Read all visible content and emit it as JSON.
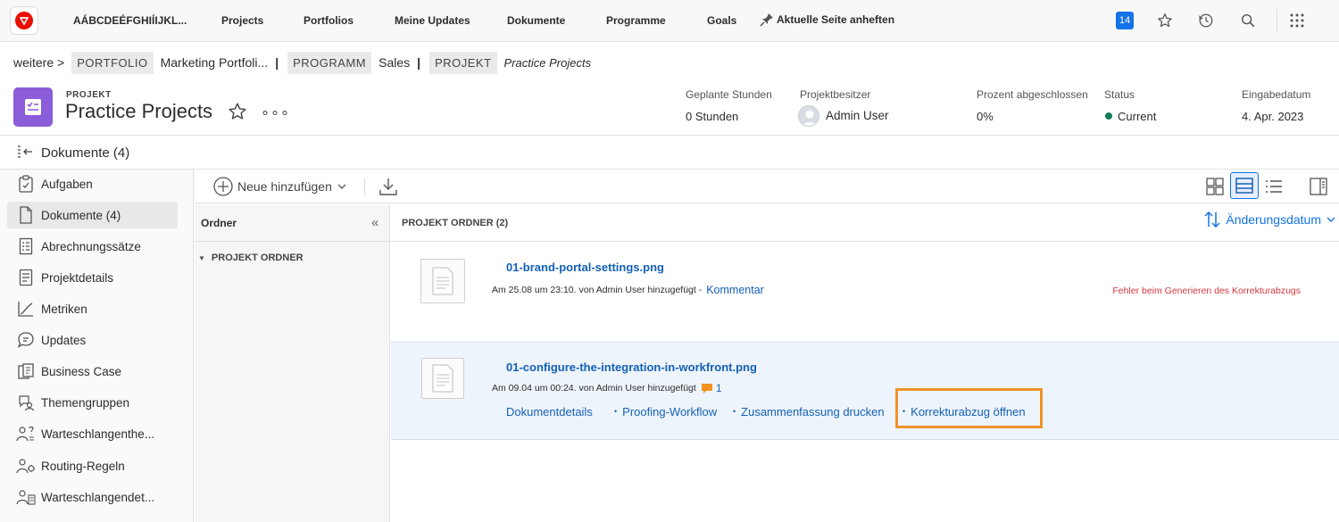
{
  "topnav": {
    "org_name": "AÁBCDEÉFGHIÍIJKL...",
    "items": [
      "Projects",
      "Portfolios",
      "Meine Updates",
      "Dokumente",
      "Programme",
      "Goals"
    ],
    "pin_label": "Aktuelle Seite anheften",
    "notification_count": "14"
  },
  "breadcrumb": {
    "more": "weitere >",
    "portfolio_tag": "PORTFOLIO",
    "portfolio_name": "Marketing Portfoli...",
    "program_tag": "PROGRAMM",
    "program_name": "Sales",
    "project_tag": "PROJEKT",
    "project_name": "Practice Projects",
    "separator": "|"
  },
  "project": {
    "type_label": "PROJEKT",
    "title": "Practice Projects",
    "more": "∘∘∘",
    "fields": {
      "planned_hours_label": "Geplante Stunden",
      "planned_hours_value": "0 Stunden",
      "owner_label": "Projektbesitzer",
      "owner_value": "Admin User",
      "percent_label": "Prozent abgeschlossen",
      "percent_value": "0%",
      "status_label": "Status",
      "status_value": "Current",
      "entry_date_label": "Eingabedatum",
      "entry_date_value": "4. Apr. 2023"
    }
  },
  "section": {
    "title": "Dokumente (4)"
  },
  "leftnav": {
    "items": [
      {
        "label": "Aufgaben"
      },
      {
        "label": "Dokumente (4)"
      },
      {
        "label": "Abrechnungssätze"
      },
      {
        "label": "Projektdetails"
      },
      {
        "label": "Metriken"
      },
      {
        "label": "Updates"
      },
      {
        "label": "Business Case"
      },
      {
        "label": "Themengruppen"
      },
      {
        "label": "Warteschlangenthe..."
      },
      {
        "label": "Routing-Regeln"
      },
      {
        "label": "Warteschlangendet..."
      }
    ]
  },
  "toolbar": {
    "add_label": "Neue hinzufügen"
  },
  "folders": {
    "title": "Ordner",
    "collapse": "«",
    "items": [
      "PROJEKT ORDNER"
    ]
  },
  "main": {
    "title": "PROJEKT ORDNER (2)",
    "sort_label": "Änderungsdatum",
    "documents": [
      {
        "name": "01-brand-portal-settings.png",
        "meta": "Am 25.08 um 23:10. von Admin User hinzugefügt -",
        "comment_link": "Kommentar",
        "error": "Fehler beim Generieren des Korrekturabzugs"
      },
      {
        "name": "01-configure-the-integration-in-workfront.png",
        "meta": "Am 09.04 um 00:24. von Admin User hinzugefügt",
        "comment_count": "1",
        "actions": [
          "Dokumentdetails",
          "Proofing-Workflow",
          "Zusammenfassung drucken",
          "Korrekturabzug öffnen"
        ]
      }
    ]
  },
  "colors": {
    "accent": "#1473e6",
    "link": "#1460b8",
    "highlight": "#f0922b",
    "error": "#d7373f",
    "project_icon": "#8c5dd9",
    "status_current": "#12805c"
  }
}
